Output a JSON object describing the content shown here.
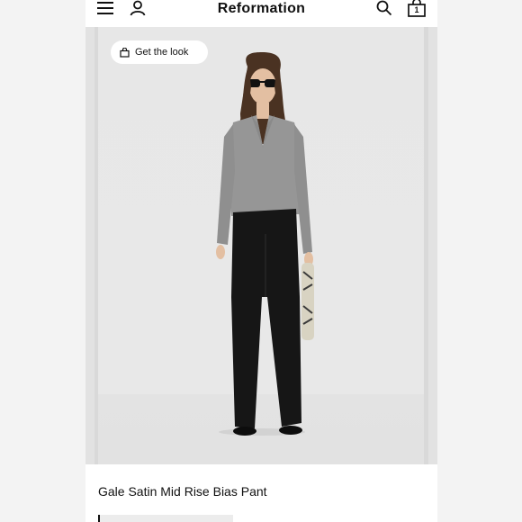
{
  "header": {
    "brand": "Reformation",
    "cart_count": "1",
    "icons": [
      "menu-icon",
      "account-icon",
      "search-icon",
      "cart-icon"
    ]
  },
  "gallery": {
    "cta_label": "Get the look",
    "cta_icon": "bag-icon"
  },
  "product": {
    "title": "Gale Satin Mid Rise Bias Pant"
  },
  "colors": {
    "page_bg": "#f3f3f3",
    "photo_bg": "#e8e8e8",
    "text": "#111111"
  }
}
